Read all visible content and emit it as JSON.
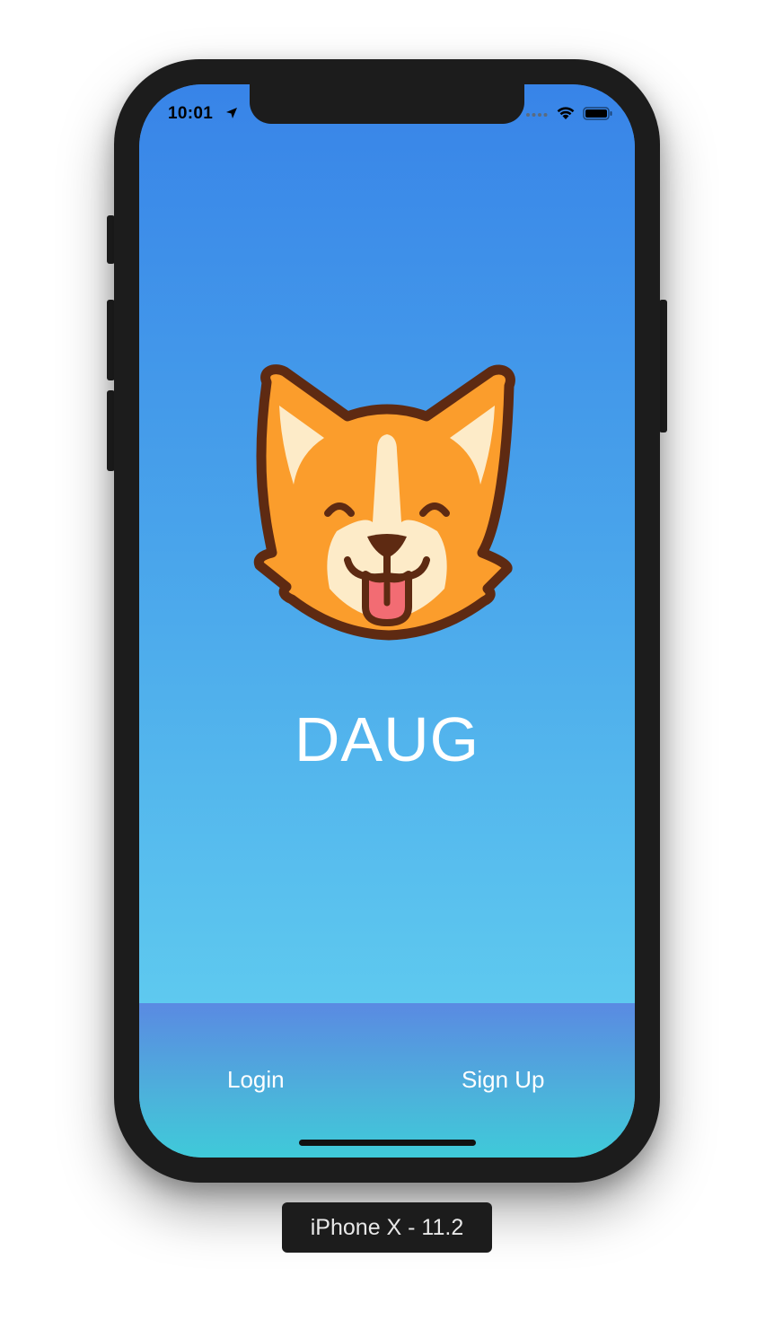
{
  "status_bar": {
    "time": "10:01",
    "location_icon": "location-arrow-icon",
    "signal_icon": "cellular-signal-icon",
    "wifi_icon": "wifi-icon",
    "battery_icon": "battery-icon"
  },
  "app": {
    "logo_icon": "corgi-dog-icon",
    "title": "DAUG"
  },
  "bottom_bar": {
    "login_label": "Login",
    "signup_label": "Sign Up"
  },
  "simulator": {
    "device_label": "iPhone X - 11.2"
  },
  "colors": {
    "gradient_top": "#3884e8",
    "gradient_bottom": "#5ec9ef",
    "bottom_bar_top": "#5a8ae2",
    "bottom_bar_bottom": "#3fcad9",
    "dog_orange": "#fb9d2c",
    "dog_cream": "#fdebc8",
    "dog_outline": "#5e2a12",
    "tongue": "#f26c73"
  }
}
